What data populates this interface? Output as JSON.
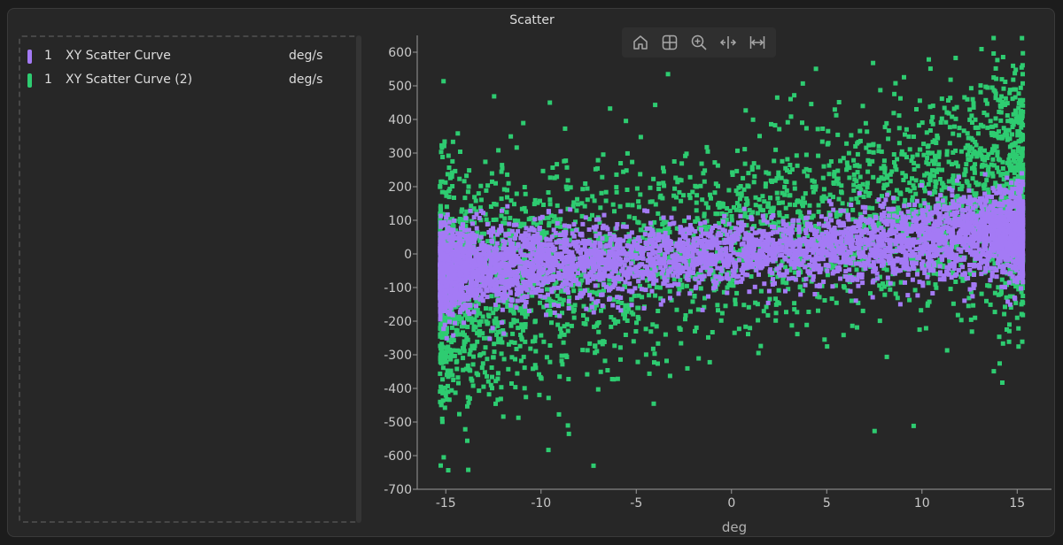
{
  "window": {
    "title": "Scatter"
  },
  "legend": {
    "items": [
      {
        "index": "1",
        "name": "XY Scatter Curve",
        "unit": "deg/s",
        "color": "#a47af5"
      },
      {
        "index": "1",
        "name": "XY Scatter Curve (2)",
        "unit": "deg/s",
        "color": "#2ecc71"
      }
    ]
  },
  "toolbar": {
    "buttons": [
      {
        "icon": "home-icon",
        "action": "reset-view"
      },
      {
        "icon": "grid-icon",
        "action": "toggle-grid"
      },
      {
        "icon": "zoom-in-icon",
        "action": "zoom"
      },
      {
        "icon": "horizontal-pan-icon",
        "action": "pan-x"
      },
      {
        "icon": "fit-width-icon",
        "action": "fit-x"
      }
    ]
  },
  "chart_data": {
    "type": "scatter",
    "title": "",
    "xlabel": "deg",
    "ylabel": "",
    "xlim": [
      -16.5,
      16.8
    ],
    "ylim": [
      -700,
      650
    ],
    "xticks": [
      -15,
      -10,
      -5,
      0,
      5,
      10,
      15
    ],
    "yticks": [
      600,
      500,
      400,
      300,
      200,
      100,
      0,
      -100,
      -200,
      -300,
      -400,
      -500,
      -600,
      -700
    ],
    "grid": false,
    "legend_position": "left-panel",
    "series": [
      {
        "name": "XY Scatter Curve (2)",
        "color": "#2ecc71",
        "x_range": [
          -15.3,
          15.3
        ],
        "y_trend_at_xmin": -120,
        "y_trend_at_xmax": 210,
        "y_spread": 170,
        "point_count": 3400
      },
      {
        "name": "XY Scatter Curve",
        "color": "#a47af5",
        "x_range": [
          -15.3,
          15.3
        ],
        "y_trend_at_xmin": -50,
        "y_trend_at_xmax": 60,
        "y_spread": 60,
        "point_count": 4500
      }
    ]
  }
}
